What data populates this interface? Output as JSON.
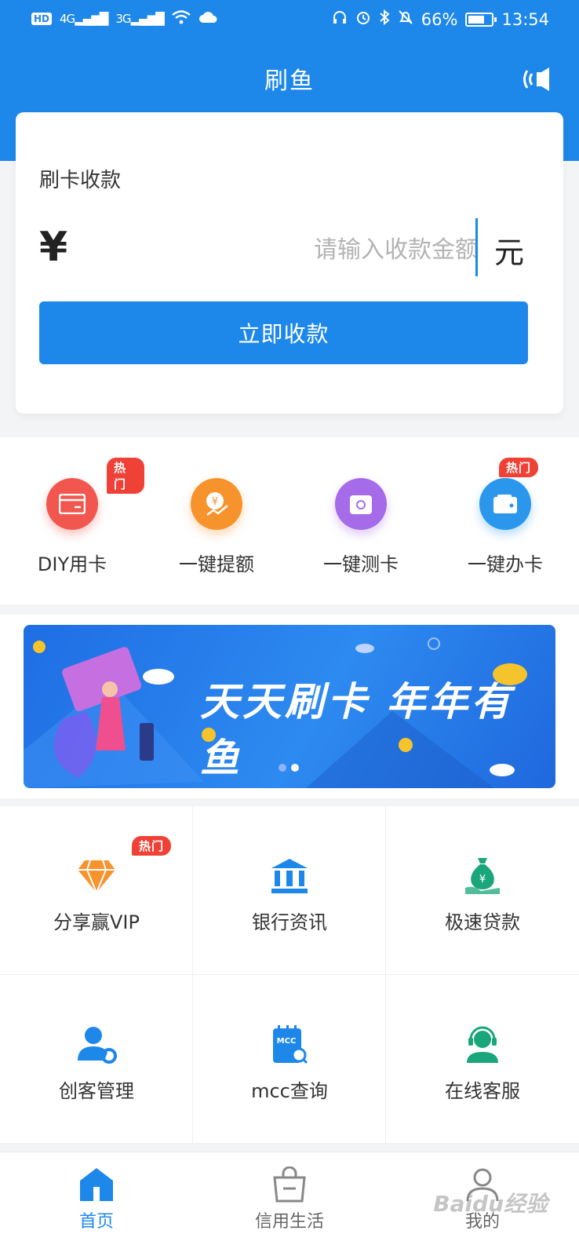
{
  "status_bar": {
    "hd": "HD",
    "signal_1": "4G",
    "signal_2": "3G",
    "battery": "66%",
    "time": "13:54"
  },
  "nav": {
    "title": "刷鱼"
  },
  "collect": {
    "label": "刷卡收款",
    "currency_symbol": "¥",
    "amount_placeholder": "请输入收款金额",
    "amount_value": "",
    "unit": "元",
    "submit_label": "立即收款"
  },
  "quick_actions": [
    {
      "label": "DIY用卡",
      "badge": "热门",
      "color": "#f2574f"
    },
    {
      "label": "一键提额",
      "badge": "",
      "color": "#f7932d"
    },
    {
      "label": "一键测卡",
      "badge": "",
      "color": "#a56be8"
    },
    {
      "label": "一键办卡",
      "badge": "热门",
      "color": "#2a97ec"
    }
  ],
  "banner": {
    "text": "天天刷卡  年年有鱼"
  },
  "services": [
    {
      "label": "分享赢VIP",
      "badge": "热门",
      "icon": "diamond-icon"
    },
    {
      "label": "银行资讯",
      "badge": "",
      "icon": "bank-icon"
    },
    {
      "label": "极速贷款",
      "badge": "",
      "icon": "money-bag-icon"
    },
    {
      "label": "创客管理",
      "badge": "",
      "icon": "user-gear-icon"
    },
    {
      "label": "mcc查询",
      "badge": "",
      "icon": "mcc-search-icon"
    },
    {
      "label": "在线客服",
      "badge": "",
      "icon": "headset-agent-icon"
    }
  ],
  "tabs": [
    {
      "label": "首页",
      "active": true
    },
    {
      "label": "信用生活",
      "active": false
    },
    {
      "label": "我的",
      "active": false
    }
  ],
  "watermark": "Baidu经验",
  "colors": {
    "primary": "#1d88ea",
    "hot": "#f04137",
    "service_icon": "#1d88ea",
    "service_icon_alt": "#1aa67a",
    "diamond": "#f7932d"
  }
}
